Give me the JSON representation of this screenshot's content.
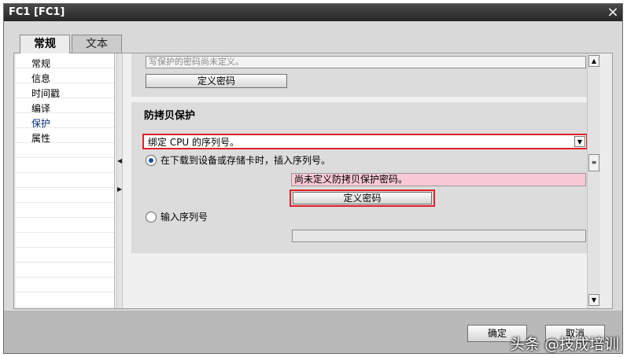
{
  "window": {
    "title": "FC1 [FC1]",
    "close_symbol": "×"
  },
  "tabs": [
    {
      "label": "常规",
      "active": true
    },
    {
      "label": "文本",
      "active": false
    }
  ],
  "nav": {
    "items": [
      {
        "label": "常规"
      },
      {
        "label": "信息"
      },
      {
        "label": "时间戳"
      },
      {
        "label": "编译"
      },
      {
        "label": "保护",
        "selected": true
      },
      {
        "label": "属性"
      }
    ]
  },
  "write_protect": {
    "status_text": "写保护的密码尚未定义。",
    "button_label": "定义密码"
  },
  "copy_protection": {
    "title": "防拷贝保护",
    "mode_value": "绑定 CPU 的序列号。",
    "option_insert": "在下载到设备或存储卡时，插入序列号。",
    "password_status": "尚未定义防拷贝保护密码。",
    "button_label": "定义密码",
    "option_enter": "输入序列号",
    "serial_value": ""
  },
  "footer": {
    "ok_label": "确定",
    "cancel_label": "取消"
  },
  "watermark": "头条 @技成培训",
  "colors": {
    "highlight": "#e0202a",
    "warning_field": "#f8c9d4"
  }
}
